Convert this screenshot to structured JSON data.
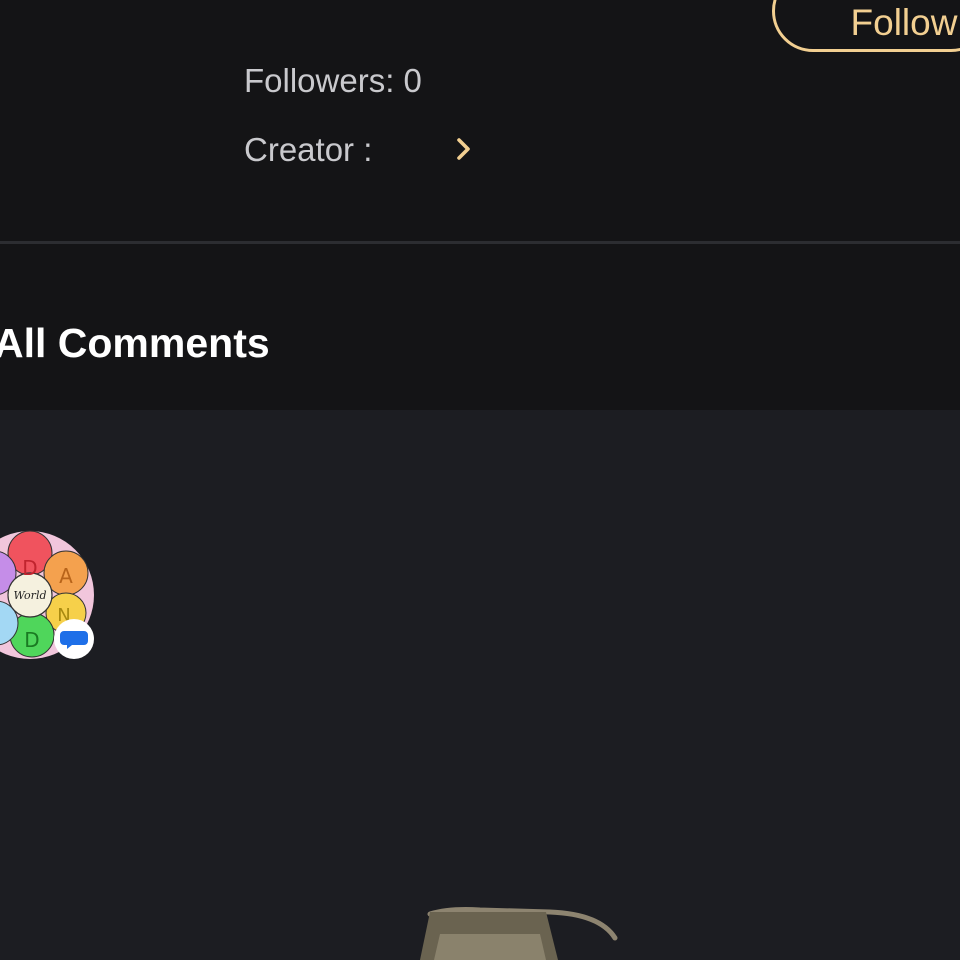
{
  "profile": {
    "follow_label": "Follow",
    "followers_text": "Followers: 0",
    "creator_label": "Creator :",
    "chevron_icon": "chevron-right-icon"
  },
  "comments": {
    "title": "All Comments",
    "avatar_letters": [
      "D",
      "A",
      "N",
      "D"
    ],
    "avatar_center_text": "World",
    "badge_icon": "chat-bubble-icon",
    "empty_illustration_icon": "empty-comments-illustration"
  },
  "colors": {
    "background": "#1c1d22",
    "panel": "#141416",
    "accent": "#f2cf91",
    "text_primary": "#ffffff",
    "text_secondary": "#c9c9cd",
    "badge_blue": "#1e6fe8"
  }
}
